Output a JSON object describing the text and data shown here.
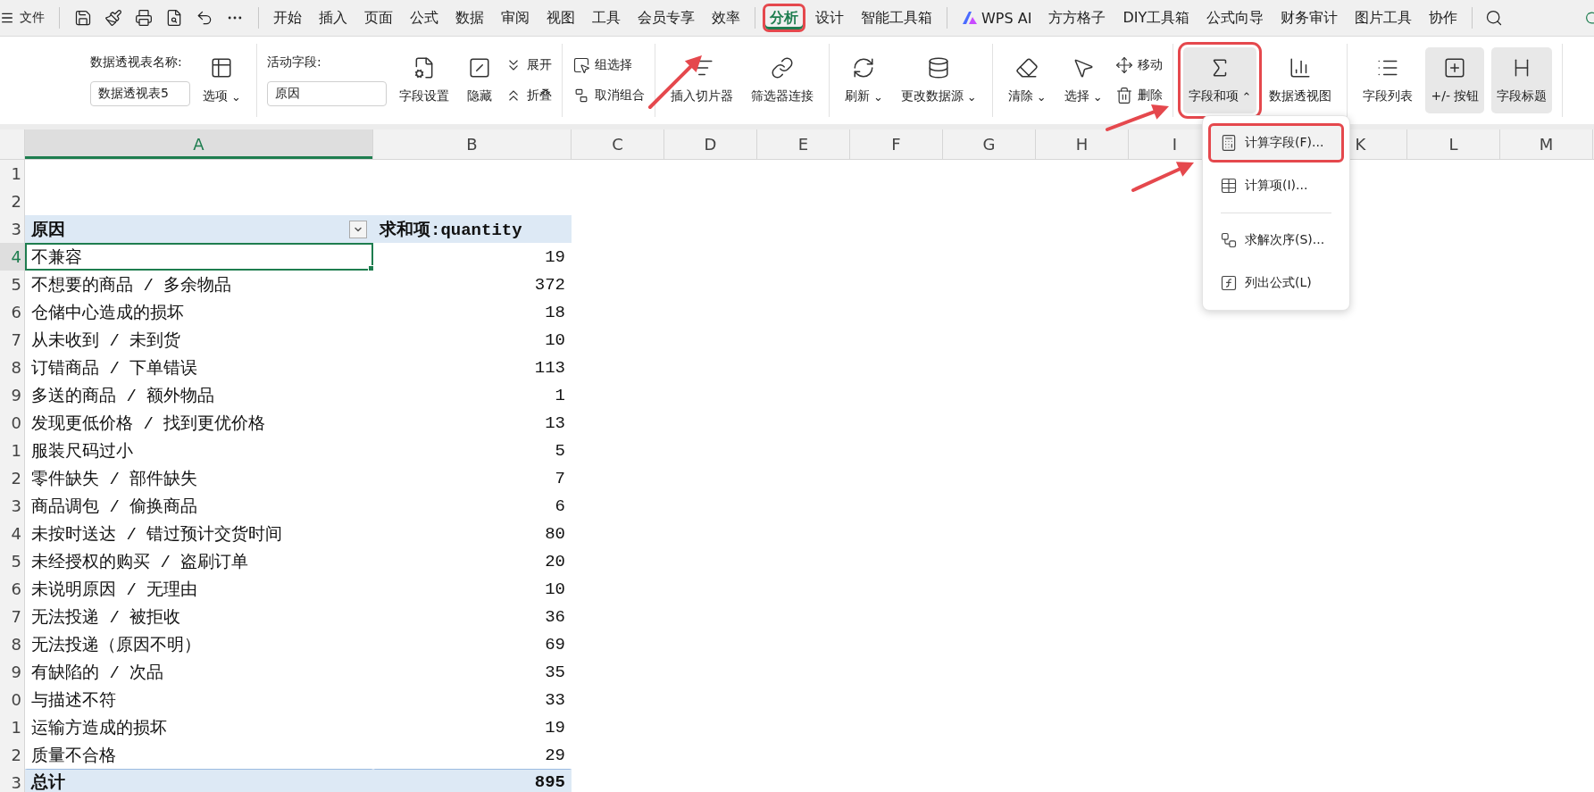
{
  "menu_bar": {
    "file_label": "文件",
    "tab_groups": [
      [
        {
          "label": "开始",
          "kind": "text",
          "selected": false,
          "highlighted": false
        },
        {
          "label": "插入",
          "kind": "text",
          "selected": false,
          "highlighted": false
        },
        {
          "label": "页面",
          "kind": "text",
          "selected": false,
          "highlighted": false
        },
        {
          "label": "公式",
          "kind": "text",
          "selected": false,
          "highlighted": false
        },
        {
          "label": "数据",
          "kind": "text",
          "selected": false,
          "highlighted": false
        },
        {
          "label": "审阅",
          "kind": "text",
          "selected": false,
          "highlighted": false
        },
        {
          "label": "视图",
          "kind": "text",
          "selected": false,
          "highlighted": false
        },
        {
          "label": "工具",
          "kind": "text",
          "selected": false,
          "highlighted": false
        },
        {
          "label": "会员专享",
          "kind": "text",
          "selected": false,
          "highlighted": false
        },
        {
          "label": "效率",
          "kind": "text",
          "selected": false,
          "highlighted": false
        }
      ],
      [
        {
          "label": "分析",
          "kind": "text",
          "selected": true,
          "highlighted": true
        },
        {
          "label": "设计",
          "kind": "text",
          "selected": false,
          "highlighted": false
        },
        {
          "label": "智能工具箱",
          "kind": "text",
          "selected": false,
          "highlighted": false
        }
      ],
      [
        {
          "label": "WPS AI",
          "kind": "ai",
          "selected": false,
          "highlighted": false
        },
        {
          "label": "方方格子",
          "kind": "text",
          "selected": false,
          "highlighted": false
        },
        {
          "label": "DIY工具箱",
          "kind": "text",
          "selected": false,
          "highlighted": false
        },
        {
          "label": "公式向导",
          "kind": "text",
          "selected": false,
          "highlighted": false
        },
        {
          "label": "财务审计",
          "kind": "text",
          "selected": false,
          "highlighted": false
        },
        {
          "label": "图片工具",
          "kind": "text",
          "selected": false,
          "highlighted": false
        },
        {
          "label": "协作",
          "kind": "text",
          "selected": false,
          "highlighted": false
        }
      ]
    ]
  },
  "ribbon": [
    {
      "items": [
        {
          "kind": "field",
          "label": "数据透视表名称:",
          "value": "数据透视表5"
        },
        {
          "kind": "large",
          "label": "选项",
          "caret": "⌄",
          "pressed": false,
          "highlighted": false
        }
      ]
    },
    {
      "items": [
        {
          "kind": "field",
          "label": "活动字段:",
          "value": "原因"
        },
        {
          "kind": "large",
          "label": "字段设置",
          "pressed": false,
          "highlighted": false
        },
        {
          "kind": "large",
          "label": "隐藏",
          "pressed": false,
          "highlighted": false
        },
        {
          "kind": "stack",
          "entries": [
            {
              "label": "展开"
            },
            {
              "label": "折叠"
            }
          ]
        }
      ]
    },
    {
      "items": [
        {
          "kind": "stack",
          "entries": [
            {
              "label": "组选择"
            },
            {
              "label": "取消组合"
            }
          ]
        }
      ]
    },
    {
      "items": [
        {
          "kind": "large",
          "label": "插入切片器",
          "pressed": false,
          "highlighted": false
        },
        {
          "kind": "large",
          "label": "筛选器连接",
          "pressed": false,
          "highlighted": false
        }
      ]
    },
    {
      "items": [
        {
          "kind": "large",
          "label": "刷新",
          "caret": "⌄",
          "pressed": false,
          "highlighted": false
        },
        {
          "kind": "large",
          "label": "更改数据源",
          "caret": "⌄",
          "pressed": false,
          "highlighted": false
        }
      ]
    },
    {
      "items": [
        {
          "kind": "large",
          "label": "清除",
          "caret": "⌄",
          "pressed": false,
          "highlighted": false
        },
        {
          "kind": "large",
          "label": "选择",
          "caret": "⌄",
          "pressed": false,
          "highlighted": false
        },
        {
          "kind": "stack",
          "entries": [
            {
              "label": "移动"
            },
            {
              "label": "删除"
            }
          ]
        }
      ]
    },
    {
      "items": [
        {
          "kind": "large",
          "label": "字段和项",
          "caret": "⌃",
          "pressed": true,
          "highlighted": true
        },
        {
          "kind": "large",
          "label": "数据透视图",
          "pressed": false,
          "highlighted": false
        }
      ]
    },
    {
      "items": [
        {
          "kind": "large",
          "label": "字段列表",
          "pressed": false,
          "highlighted": false
        },
        {
          "kind": "large",
          "label": "+/- 按钮",
          "pressed": true,
          "highlighted": false
        },
        {
          "kind": "large",
          "label": "字段标题",
          "pressed": true,
          "highlighted": false
        }
      ]
    }
  ],
  "sheet": {
    "columns": [
      {
        "label": "A",
        "selected": true
      },
      {
        "label": "B",
        "selected": false
      },
      {
        "label": "C",
        "selected": false
      },
      {
        "label": "D",
        "selected": false
      },
      {
        "label": "E",
        "selected": false
      },
      {
        "label": "F",
        "selected": false
      },
      {
        "label": "G",
        "selected": false
      },
      {
        "label": "H",
        "selected": false
      },
      {
        "label": "I",
        "selected": false
      },
      {},
      {
        "label": "K",
        "selected": false
      },
      {
        "label": "L",
        "selected": false
      },
      {
        "label": "M",
        "selected": false
      }
    ],
    "row_numbers": [
      "1",
      "2",
      "3",
      "4",
      "5",
      "6",
      "7",
      "8",
      "9",
      "0",
      "1",
      "2",
      "3",
      "4",
      "5",
      "6",
      "7",
      "8",
      "9",
      "0",
      "1",
      "2",
      "3"
    ],
    "pivot": {
      "field_header": "原因",
      "value_header": "求和项:quantity",
      "rows": [
        {
          "label": "不兼容",
          "value": "19",
          "selected": true
        },
        {
          "label": "不想要的商品 / 多余物品",
          "value": "372",
          "selected": false
        },
        {
          "label": "仓储中心造成的损坏",
          "value": "18",
          "selected": false
        },
        {
          "label": "从未收到 / 未到货",
          "value": "10",
          "selected": false
        },
        {
          "label": "订错商品 / 下单错误",
          "value": "113",
          "selected": false
        },
        {
          "label": "多送的商品 / 额外物品",
          "value": "1",
          "selected": false
        },
        {
          "label": "发现更低价格 / 找到更优价格",
          "value": "13",
          "selected": false
        },
        {
          "label": "服装尺码过小",
          "value": "5",
          "selected": false
        },
        {
          "label": "零件缺失 / 部件缺失",
          "value": "7",
          "selected": false
        },
        {
          "label": "商品调包 / 偷换商品",
          "value": "6",
          "selected": false
        },
        {
          "label": "未按时送达 / 错过预计交货时间",
          "value": "80",
          "selected": false
        },
        {
          "label": "未经授权的购买 / 盗刷订单",
          "value": "20",
          "selected": false
        },
        {
          "label": "未说明原因 / 无理由",
          "value": "10",
          "selected": false
        },
        {
          "label": "无法投递 / 被拒收",
          "value": "36",
          "selected": false
        },
        {
          "label": "无法投递（原因不明）",
          "value": "69",
          "selected": false
        },
        {
          "label": "有缺陷的 / 次品",
          "value": "35",
          "selected": false
        },
        {
          "label": "与描述不符",
          "value": "33",
          "selected": false
        },
        {
          "label": "运输方造成的损坏",
          "value": "19",
          "selected": false
        },
        {
          "label": "质量不合格",
          "value": "29",
          "selected": false
        }
      ],
      "total": {
        "label": "总计",
        "value": "895"
      }
    }
  },
  "dropdown_menu": {
    "groups": [
      [
        {
          "label": "计算字段(F)...",
          "highlighted": true
        },
        {
          "label": "计算项(I)...",
          "highlighted": false
        }
      ],
      [
        {
          "label": "求解次序(S)...",
          "highlighted": false
        },
        {
          "label": "列出公式(L)",
          "highlighted": false
        }
      ]
    ]
  }
}
